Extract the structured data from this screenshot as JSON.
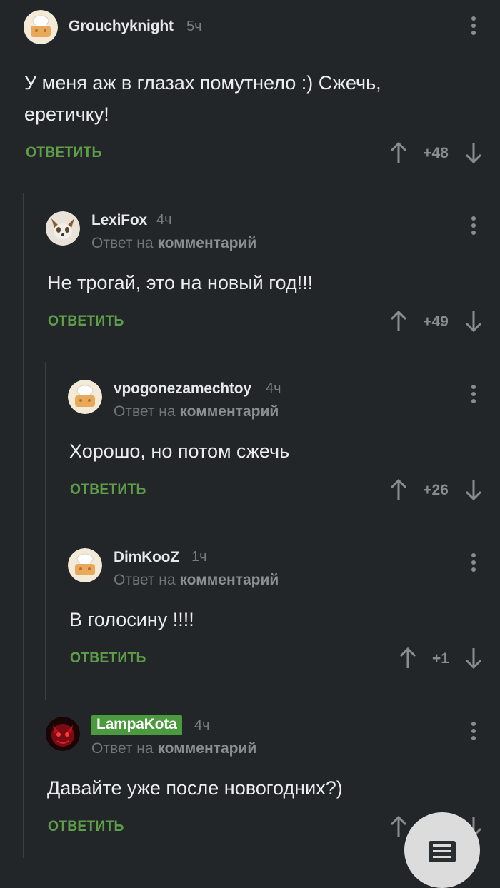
{
  "comments": [
    {
      "username": "Grouchyknight",
      "time": "5ч",
      "text": "У меня аж в глазах помутнело :) Сжечь, еретичку!",
      "reply_label": "ОТВЕТИТЬ",
      "score": "+48",
      "avatar_icon": "chef-hat-avatar"
    },
    {
      "username": "LexiFox",
      "time": "4ч",
      "reply_to_prefix": "Ответ на",
      "reply_to_link": "комментарий",
      "text": "Не трогай, это на новый год!!!",
      "reply_label": "ОТВЕТИТЬ",
      "score": "+49",
      "avatar_icon": "fox-avatar"
    },
    {
      "username": "vpogonezamechtoy",
      "time": "4ч",
      "reply_to_prefix": "Ответ на",
      "reply_to_link": "комментарий",
      "text": "Хорошо, но потом сжечь",
      "reply_label": "ОТВЕТИТЬ",
      "score": "+26",
      "avatar_icon": "chef-hat-avatar"
    },
    {
      "username": "DimKooZ",
      "time": "1ч",
      "reply_to_prefix": "Ответ на",
      "reply_to_link": "комментарий",
      "text": "В голосину !!!!",
      "reply_label": "ОТВЕТИТЬ",
      "score": "+1",
      "avatar_icon": "chef-hat-avatar"
    },
    {
      "username": "LampaKota",
      "time": "4ч",
      "reply_to_prefix": "Ответ на",
      "reply_to_link": "комментарий",
      "text": "Давайте уже после новогодних?)",
      "reply_label": "ОТВЕТИТЬ",
      "score": "",
      "avatar_icon": "red-cat-avatar"
    }
  ],
  "colors": {
    "background": "#232629",
    "accent_green": "#5f9e49",
    "badge_green": "#4c9a3f",
    "muted": "#8a8d90"
  },
  "fab_icon": "comments-list-icon"
}
